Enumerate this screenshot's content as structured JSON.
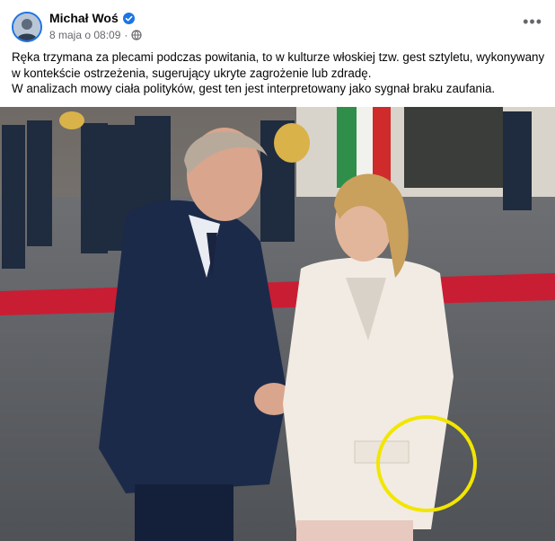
{
  "post": {
    "author": "Michał Woś",
    "verified_icon": "verified-badge-icon",
    "date": "8 maja o 08:09",
    "separator": "·",
    "audience_icon": "globe-icon",
    "more_label": "•••",
    "body_lines": [
      "Ręka trzymana za plecami podczas powitania, to w kulturze włoskiej tzw. gest sztyletu, wykonywany w kontekście ostrzeżenia, sugerujący ukryte zagrożenie lub zdradę.",
      "W analizach mowy ciała polityków, gest ten jest interpretowany jako sygnał braku zaufania."
    ]
  },
  "colors": {
    "accent": "#1b74e4",
    "meta_text": "#65676b",
    "highlight_circle": "#f2e600"
  }
}
